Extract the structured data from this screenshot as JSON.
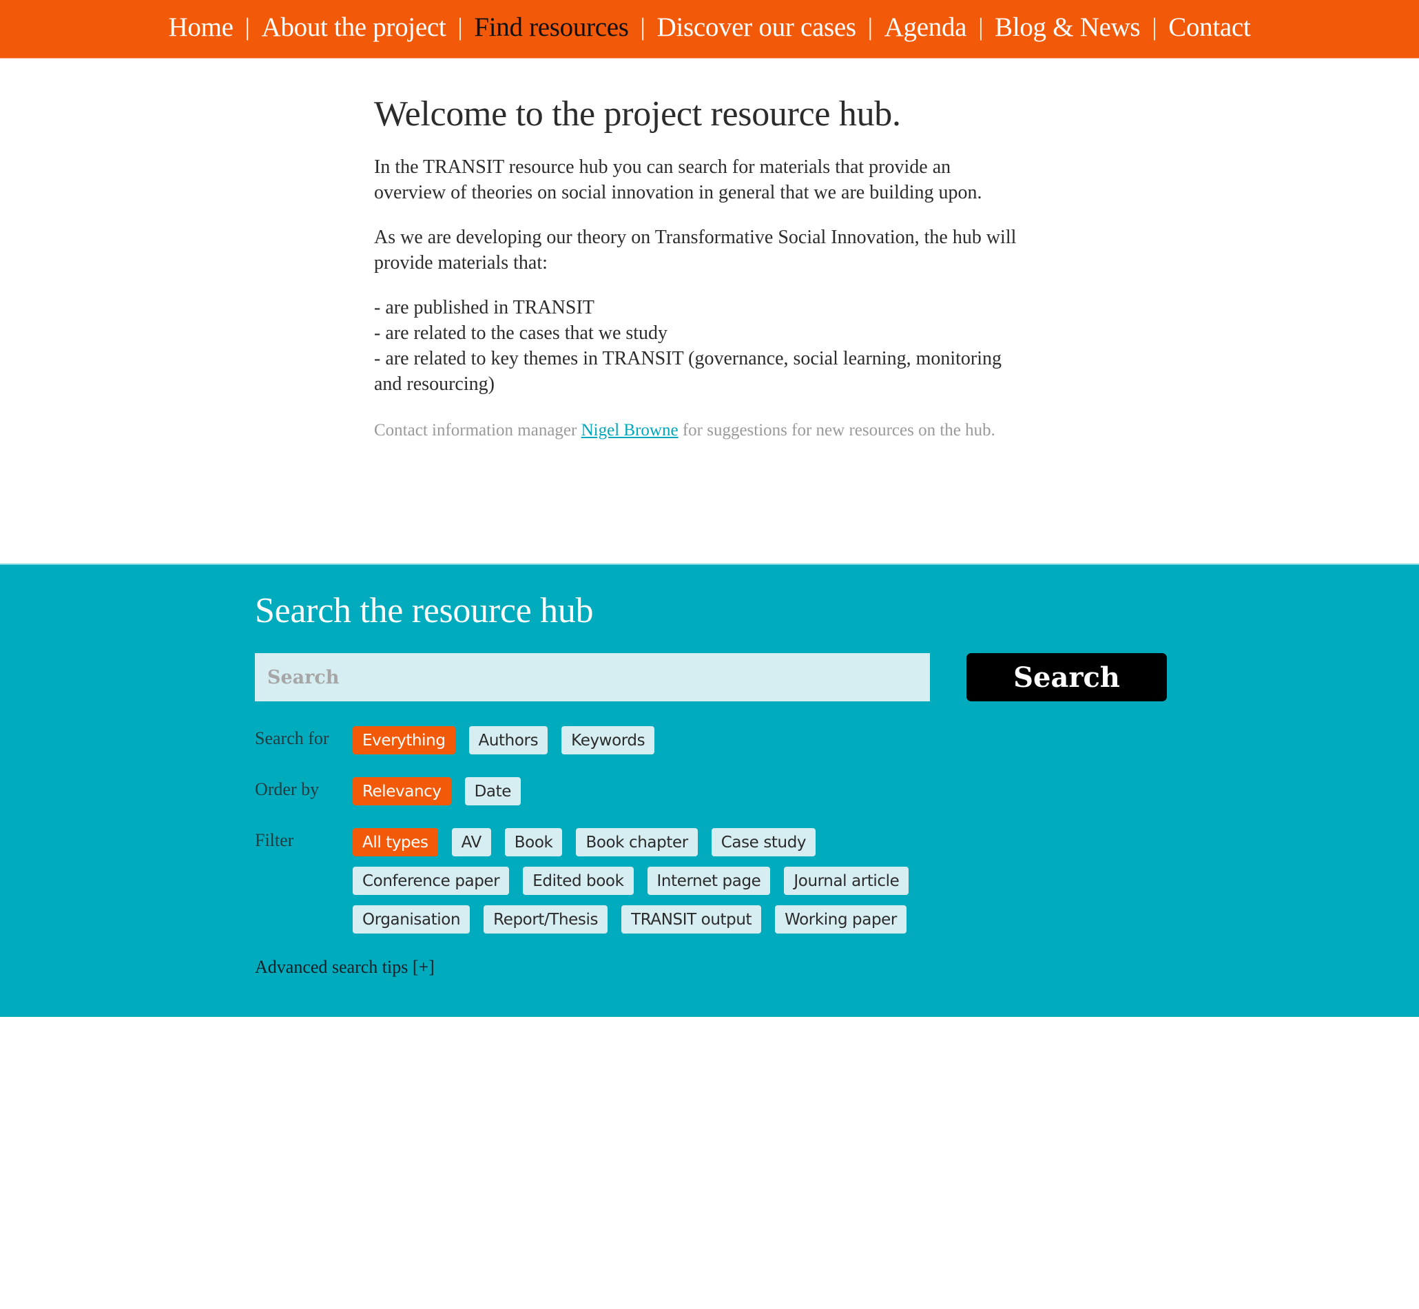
{
  "nav": {
    "items": [
      {
        "label": "Home",
        "active": false
      },
      {
        "label": "About the project",
        "active": false
      },
      {
        "label": "Find resources",
        "active": true
      },
      {
        "label": "Discover our cases",
        "active": false
      },
      {
        "label": "Agenda",
        "active": false
      },
      {
        "label": "Blog & News",
        "active": false
      },
      {
        "label": "Contact",
        "active": false
      }
    ],
    "separator": "|"
  },
  "intro": {
    "title": "Welcome to the project resource hub.",
    "paragraph1": "In the TRANSIT resource hub you can search for materials that provide an overview of theories on social innovation in general that we are building upon.",
    "paragraph2": "As we are developing our theory on Transformative Social Innovation, the hub will provide materials that:",
    "list": [
      "- are published in TRANSIT",
      "- are related to the cases that we study",
      "- are related to key themes in TRANSIT (governance, social learning, monitoring and resourcing)"
    ],
    "contact": {
      "before": "Contact information manager ",
      "link_text": "Nigel Browne",
      "after": " for suggestions for new resources on the hub."
    }
  },
  "search": {
    "title": "Search the resource hub",
    "input_value": "",
    "input_placeholder": "Search",
    "button_label": "Search",
    "search_for": {
      "label": "Search for",
      "options": [
        {
          "label": "Everything",
          "active": true
        },
        {
          "label": "Authors",
          "active": false
        },
        {
          "label": "Keywords",
          "active": false
        }
      ]
    },
    "order_by": {
      "label": "Order by",
      "options": [
        {
          "label": "Relevancy",
          "active": true
        },
        {
          "label": "Date",
          "active": false
        }
      ]
    },
    "filter": {
      "label": "Filter",
      "options": [
        {
          "label": "All types",
          "active": true
        },
        {
          "label": "AV",
          "active": false
        },
        {
          "label": "Book",
          "active": false
        },
        {
          "label": "Book chapter",
          "active": false
        },
        {
          "label": "Case study",
          "active": false
        },
        {
          "label": "Conference paper",
          "active": false
        },
        {
          "label": "Edited book",
          "active": false
        },
        {
          "label": "Internet page",
          "active": false
        },
        {
          "label": "Journal article",
          "active": false
        },
        {
          "label": "Organisation",
          "active": false
        },
        {
          "label": "Report/Thesis",
          "active": false
        },
        {
          "label": "TRANSIT output",
          "active": false
        },
        {
          "label": "Working paper",
          "active": false
        }
      ]
    },
    "advanced_tips": "Advanced search tips [+]"
  },
  "colors": {
    "brand_orange": "#f25a0a",
    "brand_teal": "#00abbe",
    "pill_bg": "#d6edf1",
    "link": "#00a8bd",
    "button_bg": "#000000"
  }
}
